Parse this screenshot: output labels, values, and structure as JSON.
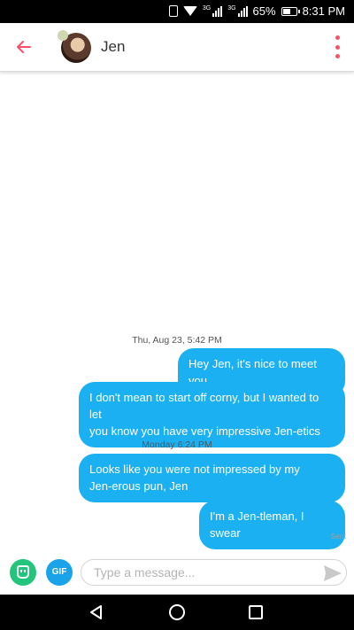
{
  "status_bar": {
    "network_1": "3G",
    "network_2": "3G",
    "battery": "65%",
    "battery_level": 0.65,
    "time": "8:31 PM",
    "icons": [
      "vibrate-icon",
      "wifi-icon",
      "signal-icon",
      "signal-icon",
      "battery-icon"
    ]
  },
  "header": {
    "back_icon": "arrow-left-icon",
    "contact_name": "Jen",
    "menu_icon": "more-vertical-icon",
    "accent_color": "#fd5068"
  },
  "conversation": {
    "groups": [
      {
        "timestamp": "Thu, Aug 23, 5:42 PM",
        "messages": [
          "Hey Jen, it's nice to meet you",
          "I don't mean to start off corny, but I wanted to let\nyou know you have very impressive Jen-etics"
        ]
      },
      {
        "timestamp": "Monday 6:24 PM",
        "messages": [
          "Looks like you were not impressed by my\nJen-erous pun, Jen",
          "I'm a Jen-tleman, I swear"
        ]
      }
    ],
    "status": "Sent",
    "bubble_color": "#1ab0f2"
  },
  "composer": {
    "sticker_icon": "sticker-icon",
    "gif_label": "GIF",
    "placeholder": "Type a message...",
    "send_icon": "send-icon"
  },
  "nav_bar": {
    "icons": [
      "nav-back-icon",
      "nav-home-icon",
      "nav-recents-icon"
    ]
  }
}
